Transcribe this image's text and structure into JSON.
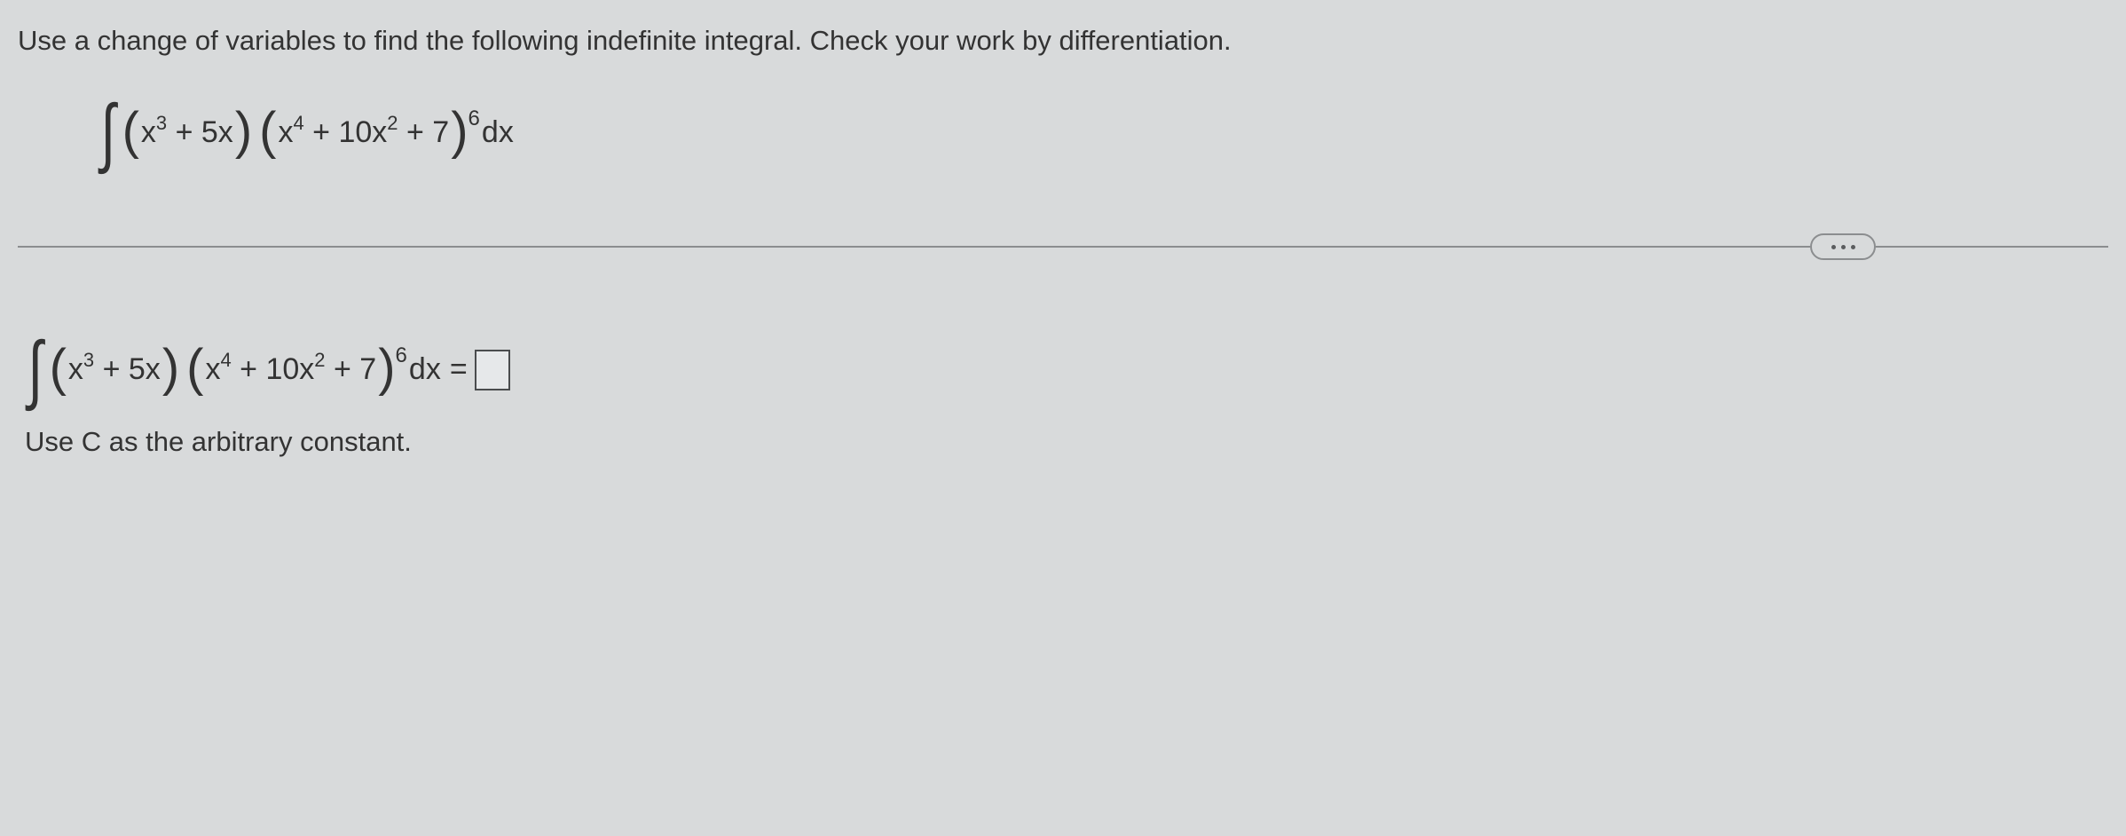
{
  "instruction": "Use a change of variables to find the following indefinite integral. Check your work by differentiation.",
  "expression": {
    "first_factor": {
      "t1": "x",
      "e1": "3",
      "op": " + 5x"
    },
    "second_factor": {
      "t1": "x",
      "e1": "4",
      "op1": " + 10x",
      "e2": "2",
      "op2": " + 7"
    },
    "outer_exp": "6",
    "diff": "dx"
  },
  "answer": {
    "equals": "=",
    "placeholder": ""
  },
  "note": "Use C as the arbitrary constant.",
  "more_label": "more"
}
